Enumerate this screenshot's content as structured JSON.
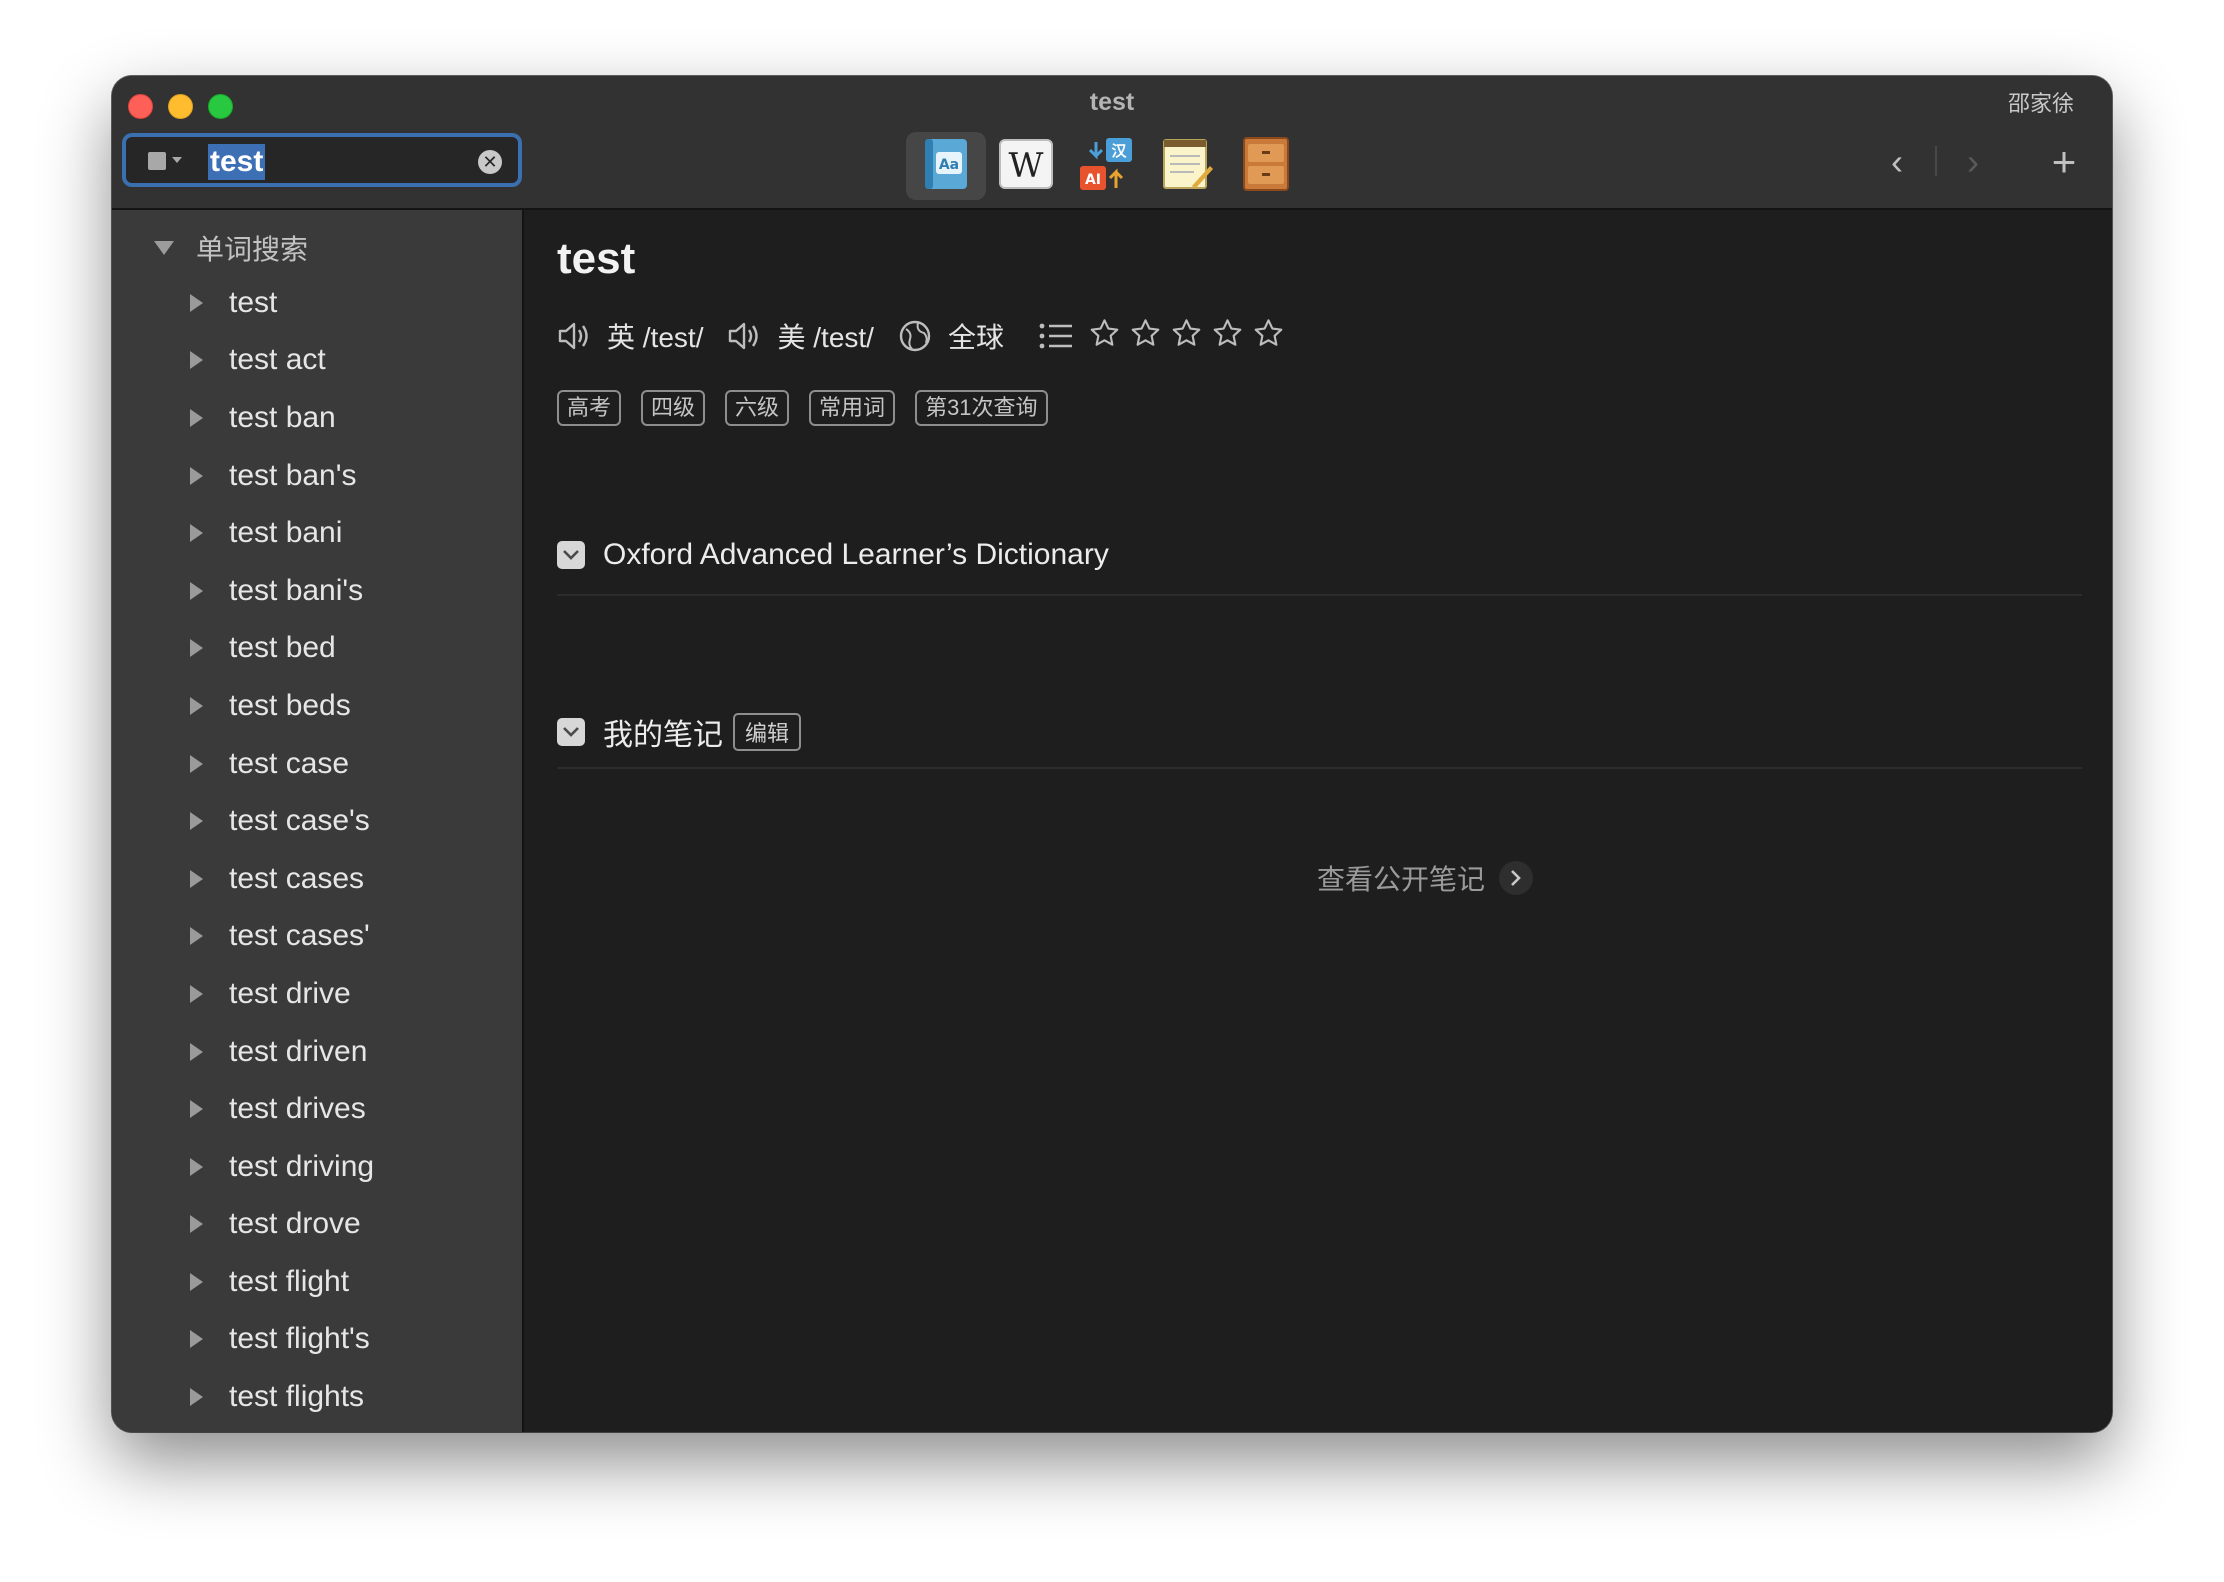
{
  "window": {
    "title": "test",
    "user_name": "邵家徐"
  },
  "search": {
    "value": "test",
    "clear_symbol": "✕"
  },
  "toolbar": {
    "tools": [
      {
        "name": "dictionary-tool",
        "icon": "dictionary-book-icon",
        "active": true
      },
      {
        "name": "wikipedia-tool",
        "icon": "wikipedia-icon",
        "active": false
      },
      {
        "name": "translate-tool",
        "icon": "ai-translate-icon",
        "active": false
      },
      {
        "name": "notepad-tool",
        "icon": "notepad-icon",
        "active": false
      },
      {
        "name": "cabinet-tool",
        "icon": "cabinet-icon",
        "active": false
      }
    ],
    "back_symbol": "‹",
    "forward_symbol": "›",
    "add_symbol": "+"
  },
  "sidebar": {
    "section_title": "单词搜索",
    "items": [
      "test",
      "test act",
      "test ban",
      "test ban's",
      "test bani",
      "test bani's",
      "test bed",
      "test beds",
      "test case",
      "test case's",
      "test cases",
      "test cases'",
      "test drive",
      "test driven",
      "test drives",
      "test driving",
      "test drove",
      "test flight",
      "test flight's",
      "test flights"
    ]
  },
  "entry": {
    "headword": "test",
    "uk_pron": "英 /test/",
    "us_pron": "美 /test/",
    "global_label": "全球",
    "star_rating": 0,
    "star_max": 5,
    "tags": [
      "高考",
      "四级",
      "六级",
      "常用词",
      "第31次查询"
    ]
  },
  "dictionaries": {
    "oxford_title": "Oxford Advanced Learner’s Dictionary",
    "notes_title": "我的笔记",
    "notes_edit_label": "编辑",
    "public_notes_link": "查看公开笔记"
  },
  "colors": {
    "selection": "#3c6fb4",
    "sidebar_bg": "#3a3a3a",
    "content_bg": "#1e1e1e"
  }
}
